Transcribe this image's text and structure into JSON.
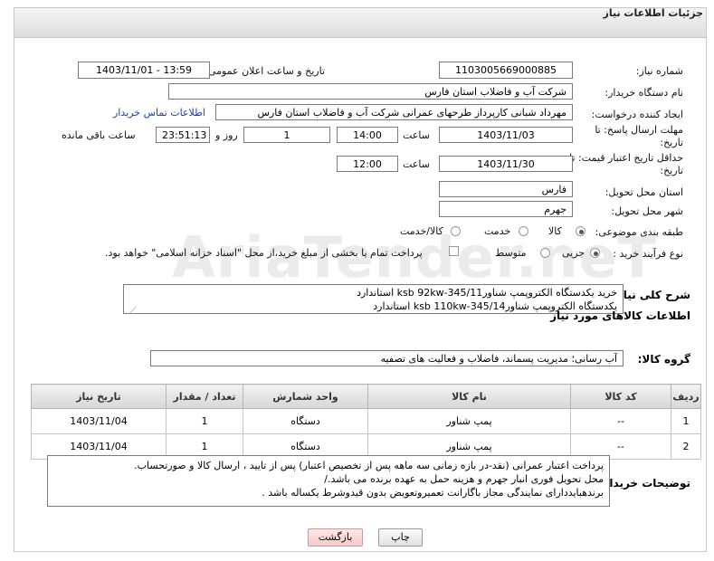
{
  "window": {
    "title": "جزئیات اطلاعات نیاز"
  },
  "watermark": {
    "text": "AriaTender.neT"
  },
  "fields": {
    "need_number": {
      "label": "شماره نیاز:",
      "value": "1103005669000885"
    },
    "announce_datetime": {
      "label": "تاریخ و ساعت اعلان عمومی:",
      "value": "1403/11/01 - 13:59"
    },
    "buyer_org": {
      "label": "نام دستگاه خریدار:",
      "value": "شرکت آب و فاضلاب استان فارس"
    },
    "requester": {
      "label": "ایجاد کننده درخواست:",
      "value": "مهرداد شبانی کارپرداز طرحهای عمرانی  شرکت آب و فاضلاب استان فارس",
      "contact_link": "اطلاعات تماس خریدار"
    },
    "reply_deadline": {
      "label_line1": "مهلت ارسال پاسخ: تا",
      "label_line2": "تاریخ:",
      "date": "1403/11/03",
      "time_label": "ساعت",
      "time": "14:00",
      "days": "1",
      "days_label": "روز و",
      "remaining_time": "23:51:13",
      "remaining_label": "ساعت باقی مانده"
    },
    "price_validity": {
      "label_line1": "حداقل تاریخ اعتبار قیمت: تا",
      "label_line2": "تاریخ:",
      "date": "1403/11/30",
      "time_label": "ساعت",
      "time": "12:00"
    },
    "delivery_province": {
      "label": "استان محل تحویل:",
      "value": "فارس"
    },
    "delivery_city": {
      "label": "شهر محل تحویل:",
      "value": "جهرم"
    },
    "category": {
      "label": "طبقه بندی موضوعی:",
      "options": [
        "کالا",
        "خدمت",
        "کالا/خدمت"
      ],
      "selected": "کالا"
    },
    "purchase_type": {
      "label": "نوع فرآیند خرید :",
      "options": [
        "جزیی",
        "متوسط"
      ],
      "selected": "جزیی",
      "note": "پرداخت تمام یا بخشی از مبلغ خرید،از محل \"اسناد خزانه اسلامی\" خواهد بود."
    }
  },
  "description": {
    "label": "شرح کلی نیاز:",
    "line1": "خرید یکدستگاه الکتروپمپ شناورksb 92kw-345/11 استاندارد",
    "line2": "یکدستگاه الکتروپمپ شناورksb 110kw-345/14 استاندارد"
  },
  "goods_section": {
    "title": "اطلاعات کالاهای مورد نیاز"
  },
  "goods_group": {
    "label": "گروه کالا:",
    "value": "آب رسانی؛ مدیریت پسماند، فاضلاب و فعالیت های تصفیه"
  },
  "table": {
    "headers": [
      "ردیف",
      "کد کالا",
      "نام کالا",
      "واحد شمارش",
      "تعداد / مقدار",
      "تاریخ نیاز"
    ],
    "rows": [
      [
        "1",
        "--",
        "پمپ شناور",
        "دستگاه",
        "1",
        "1403/11/04"
      ],
      [
        "2",
        "--",
        "پمپ شناور",
        "دستگاه",
        "1",
        "1403/11/04"
      ]
    ]
  },
  "buyer_notes": {
    "label": "توضیحات خریدار:",
    "lines": [
      "پرداخت اعتبار عمرانی (نقد-در بازه زمانی سه ماهه پس از تخصیص اعتبار) پس از تایید ، ارسال کالا  و صورتحساب.",
      "محل تحویل فوری انبار جهرم و هزینه حمل به عهده برنده می باشد./",
      "برندهبایددارای نمایندگی مجاز باگارانت تعمیروتعویض بدون قیدوشرط یکساله باشد ."
    ]
  },
  "buttons": {
    "print": "چاپ",
    "back": "بازگشت"
  }
}
